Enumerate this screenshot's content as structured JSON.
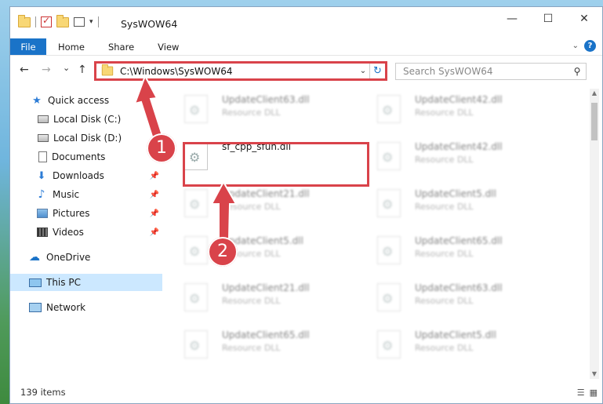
{
  "window": {
    "title": "SysWOW64",
    "controls": {
      "minimize": "—",
      "maximize": "☐",
      "close": "✕"
    }
  },
  "ribbon": {
    "tabs": [
      "File",
      "Home",
      "Share",
      "View"
    ]
  },
  "navbar": {
    "back": "←",
    "forward": "→",
    "recent": "⌄",
    "up": "↑",
    "address": "C:\\Windows\\SysWOW64",
    "search_placeholder": "Search SysWOW64"
  },
  "sidebar": {
    "items": [
      {
        "label": "Quick access",
        "icon": "star-icon"
      },
      {
        "label": "Local Disk (C:)",
        "icon": "disk-icon"
      },
      {
        "label": "Local Disk (D:)",
        "icon": "disk-icon"
      },
      {
        "label": "Documents",
        "icon": "document-icon"
      },
      {
        "label": "Downloads",
        "icon": "download-icon",
        "pinned": true
      },
      {
        "label": "Music",
        "icon": "music-icon",
        "pinned": true
      },
      {
        "label": "Pictures",
        "icon": "pictures-icon",
        "pinned": true
      },
      {
        "label": "Videos",
        "icon": "videos-icon",
        "pinned": true
      },
      {
        "label": "OneDrive",
        "icon": "cloud-icon"
      },
      {
        "label": "This PC",
        "icon": "computer-icon",
        "selected": true
      },
      {
        "label": "Network",
        "icon": "network-icon"
      }
    ]
  },
  "files": {
    "highlighted": {
      "name": "sf_cpp_sfun.dll"
    },
    "left_column": [
      {
        "name": "UpdateClient63.dll",
        "type": "Resource DLL"
      },
      {
        "name": "UpdateClient21.dll",
        "type": "Resource DLL"
      },
      {
        "name": "UpdateClient5.dll",
        "type": "Resource DLL"
      },
      {
        "name": "UpdateClient21.dll",
        "type": "Resource DLL"
      },
      {
        "name": "UpdateClient65.dll",
        "type": "Resource DLL"
      }
    ],
    "right_column": [
      {
        "name": "UpdateClient42.dll",
        "type": "Resource DLL"
      },
      {
        "name": "UpdateClient42.dll",
        "type": "Resource DLL"
      },
      {
        "name": "UpdateClient5.dll",
        "type": "Resource DLL"
      },
      {
        "name": "UpdateClient65.dll",
        "type": "Resource DLL"
      },
      {
        "name": "UpdateClient63.dll",
        "type": "Resource DLL"
      },
      {
        "name": "UpdateClient5.dll",
        "type": "Resource DLL"
      }
    ]
  },
  "status": {
    "item_count": "139 items"
  },
  "annotations": {
    "step1": "1",
    "step2": "2",
    "accent": "#d9434a"
  }
}
